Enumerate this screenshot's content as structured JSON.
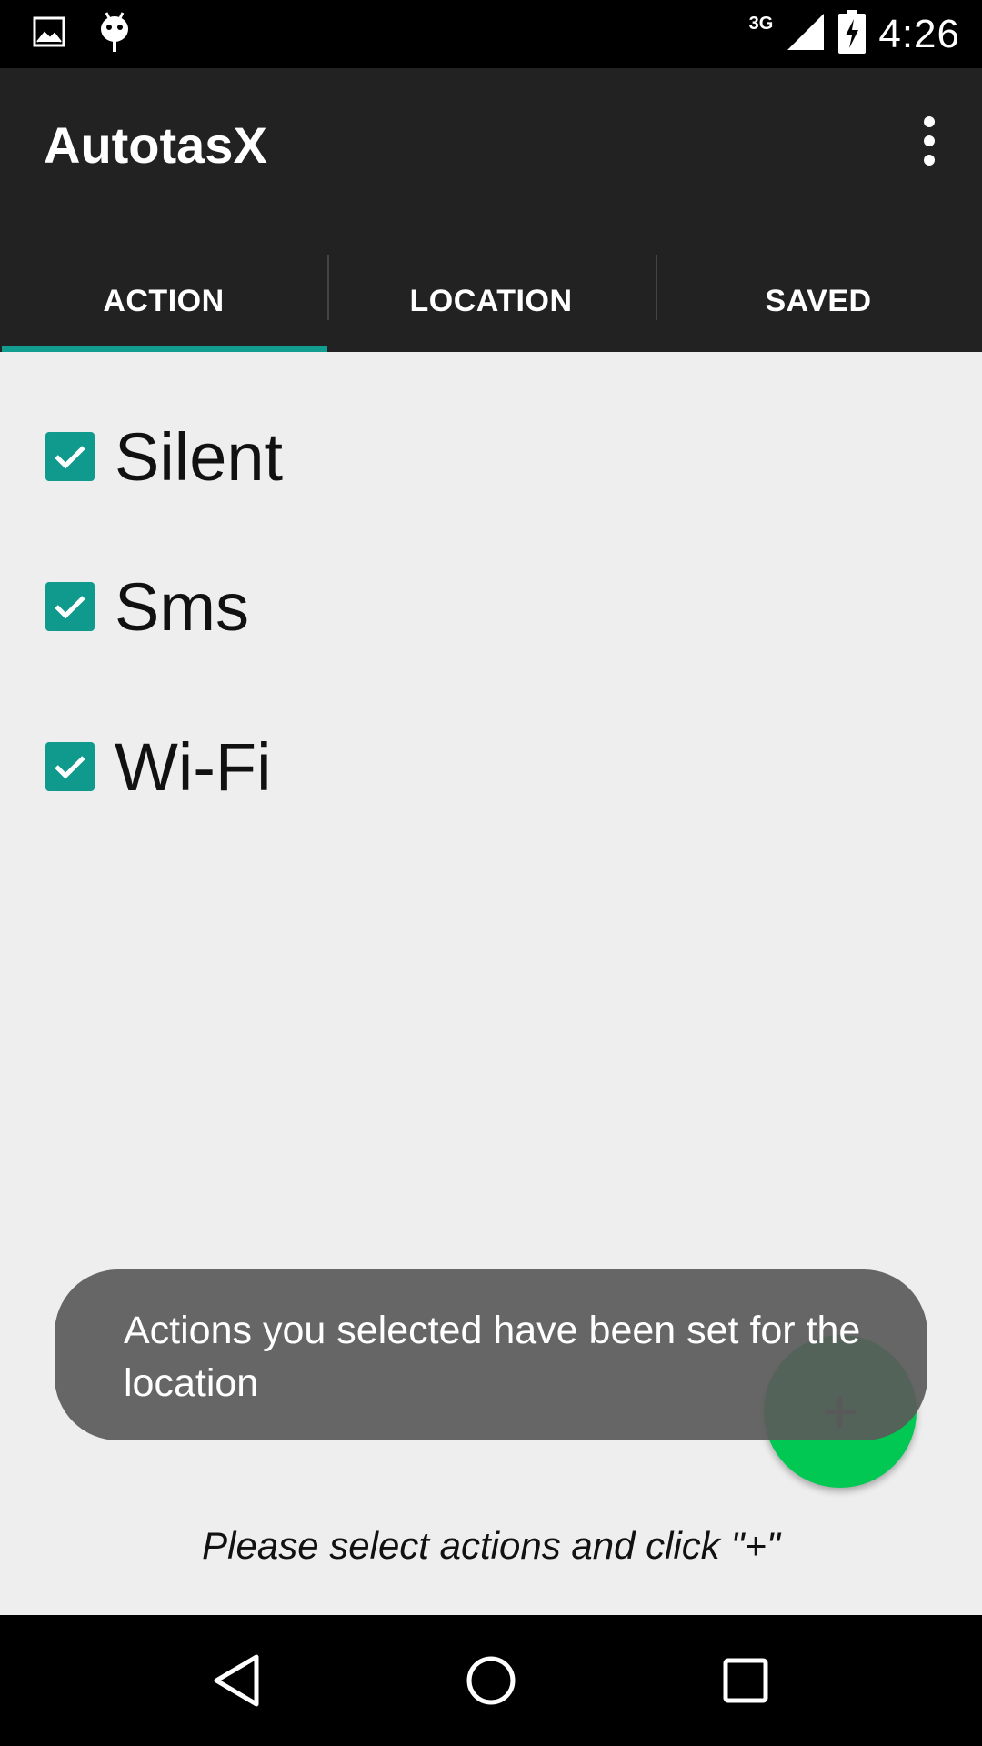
{
  "status_bar": {
    "time": "4:26",
    "network": "3G",
    "icons": [
      "image-icon",
      "android-icon",
      "signal-icon",
      "battery-charging-icon"
    ]
  },
  "app_bar": {
    "title": "AutotasX",
    "overflow_icon": "more-vert-icon"
  },
  "tabs": [
    {
      "label": "ACTION",
      "selected": true
    },
    {
      "label": "LOCATION",
      "selected": false
    },
    {
      "label": "SAVED",
      "selected": false
    }
  ],
  "actions": [
    {
      "label": "Silent",
      "checked": true
    },
    {
      "label": "Sms",
      "checked": true
    },
    {
      "label": "Wi-Fi",
      "checked": true
    }
  ],
  "toast": {
    "message": "Actions you selected have been set for the location"
  },
  "fab": {
    "label": "+",
    "color": "#00c853"
  },
  "hint": "Please select actions and click \"+\"",
  "colors": {
    "accent": "#119d8f",
    "app_bar": "#222222",
    "background": "#eeeeee"
  },
  "nav_bar": {
    "icons": [
      "back-icon",
      "home-icon",
      "recents-icon"
    ]
  }
}
